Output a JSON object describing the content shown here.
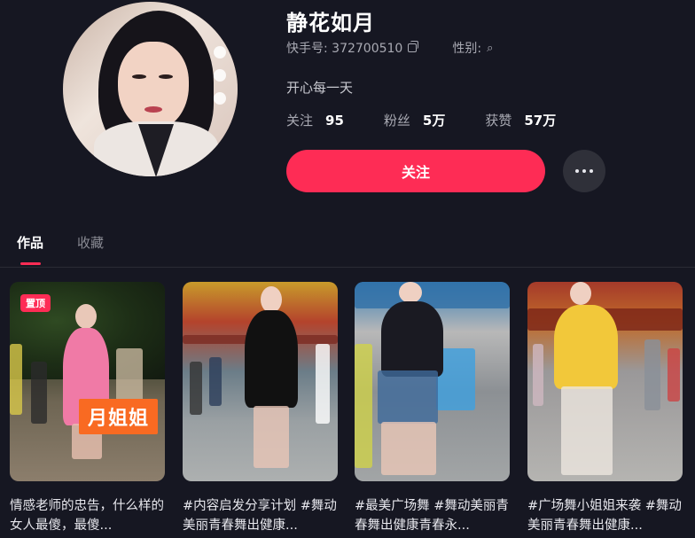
{
  "profile": {
    "name": "静花如月",
    "kuaishou_id_label": "快手号: 372700510",
    "gender_label": "性别:",
    "bio": "开心每一天",
    "stats": {
      "following_label": "关注",
      "following_value": "95",
      "followers_label": "粉丝",
      "followers_value": "5万",
      "likes_label": "获赞",
      "likes_value": "57万"
    },
    "follow_button": "关注"
  },
  "tabs": [
    {
      "label": "作品",
      "active": true
    },
    {
      "label": "收藏",
      "active": false
    }
  ],
  "videos": [
    {
      "title": "情感老师的忠告，什么样的女人最傻，最傻...",
      "pinned_badge": "置顶",
      "caption": "月姐姐"
    },
    {
      "title": "#内容启发分享计划 #舞动美丽青春舞出健康..."
    },
    {
      "title": "#最美广场舞 #舞动美丽青春舞出健康青春永..."
    },
    {
      "title": "#广场舞小姐姐来袭 #舞动美丽青春舞出健康..."
    }
  ],
  "colors": {
    "background": "#161722",
    "accent": "#fe2c55",
    "caption_orange": "#f96a22"
  },
  "icons": {
    "copy": "copy-icon",
    "gender": "search-icon",
    "more": "ellipsis-icon"
  }
}
